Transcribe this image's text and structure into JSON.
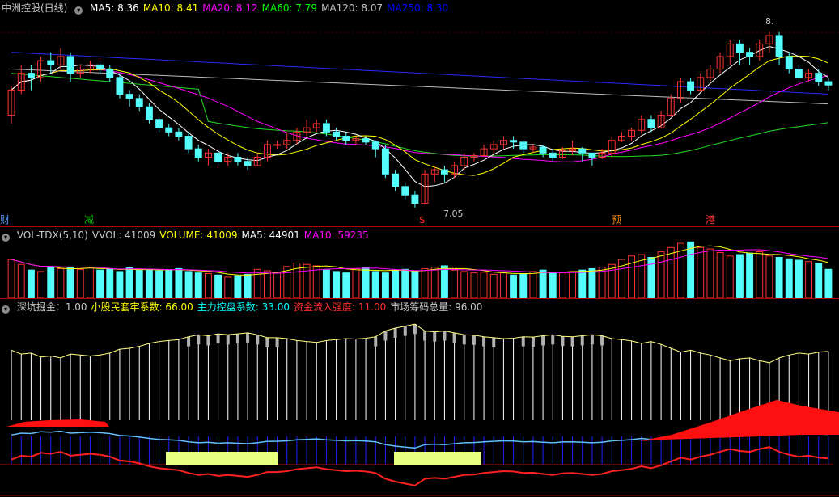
{
  "price_panel": {
    "title": "中洲控股(日线)",
    "indicators": [
      {
        "label": "MA5: 8.36",
        "color": "#ffffff"
      },
      {
        "label": "MA10: 8.41",
        "color": "#ffff00"
      },
      {
        "label": "MA20: 8.12",
        "color": "#ff00ff"
      },
      {
        "label": "MA60: 7.79",
        "color": "#00ff00"
      },
      {
        "label": "MA120: 8.07",
        "color": "#c0c0c0"
      },
      {
        "label": "MA250: 8.30",
        "color": "#0000ff"
      }
    ],
    "high_label": "8.",
    "low_label": "7.05",
    "markers": [
      {
        "text": "财",
        "color": "#5a9aff"
      },
      {
        "text": "减",
        "color": "#00cc00"
      },
      {
        "text": "$",
        "color": "#ff3030"
      },
      {
        "text": "预",
        "color": "#ff8c00"
      },
      {
        "text": "港",
        "color": "#ff3030"
      }
    ]
  },
  "volume_panel": {
    "indicators": [
      {
        "label": "VOL-TDX(5,10)",
        "color": "#c8c8c8"
      },
      {
        "label": "VVOL: 41009",
        "color": "#c8c8c8"
      },
      {
        "label": "VOLUME: 41009",
        "color": "#ffff00"
      },
      {
        "label": "MA5: 44901",
        "color": "#ffffff"
      },
      {
        "label": "MA10: 59235",
        "color": "#ff00ff"
      }
    ]
  },
  "indicator_panel": {
    "indicators": [
      {
        "label": "深坑掘金：1.00",
        "color": "#c8c8c8"
      },
      {
        "label": "小股民套牢系数: 66.00",
        "color": "#ffff00"
      },
      {
        "label": "主力控盘系数: 33.00",
        "color": "#00ffff"
      },
      {
        "label": "资金流入强度: 11.00",
        "color": "#ff3030"
      },
      {
        "label": "市场筹码总量: 96.00",
        "color": "#c8c8c8"
      }
    ]
  },
  "colors": {
    "up": "#ff3232",
    "down": "#54fcfc",
    "background": "#000000",
    "grid": "#b00000"
  },
  "chart_data": {
    "type": "candlestick",
    "candles": [
      [
        8.0,
        8.3,
        7.9,
        8.35
      ],
      [
        8.3,
        8.5,
        8.25,
        8.6
      ],
      [
        8.5,
        8.45,
        8.3,
        8.6
      ],
      [
        8.45,
        8.65,
        8.4,
        8.7
      ],
      [
        8.65,
        8.6,
        8.5,
        8.75
      ],
      [
        8.6,
        8.7,
        8.55,
        8.8
      ],
      [
        8.7,
        8.5,
        8.4,
        8.75
      ],
      [
        8.5,
        8.55,
        8.45,
        8.6
      ],
      [
        8.55,
        8.6,
        8.5,
        8.65
      ],
      [
        8.6,
        8.55,
        8.5,
        8.65
      ],
      [
        8.55,
        8.45,
        8.4,
        8.6
      ],
      [
        8.45,
        8.25,
        8.2,
        8.5
      ],
      [
        8.25,
        8.2,
        8.1,
        8.3
      ],
      [
        8.2,
        8.1,
        8.05,
        8.25
      ],
      [
        8.1,
        7.95,
        7.9,
        8.15
      ],
      [
        7.95,
        7.85,
        7.8,
        8.0
      ],
      [
        7.85,
        7.8,
        7.75,
        7.9
      ],
      [
        7.8,
        7.75,
        7.7,
        7.85
      ],
      [
        7.75,
        7.6,
        7.55,
        7.8
      ],
      [
        7.6,
        7.5,
        7.45,
        7.65
      ],
      [
        7.5,
        7.55,
        7.4,
        7.6
      ],
      [
        7.55,
        7.45,
        7.4,
        7.6
      ],
      [
        7.45,
        7.5,
        7.4,
        7.55
      ],
      [
        7.5,
        7.45,
        7.4,
        7.55
      ],
      [
        7.45,
        7.4,
        7.35,
        7.5
      ],
      [
        7.4,
        7.5,
        7.4,
        7.55
      ],
      [
        7.5,
        7.65,
        7.45,
        7.7
      ],
      [
        7.65,
        7.65,
        7.6,
        7.7
      ],
      [
        7.65,
        7.7,
        7.6,
        7.8
      ],
      [
        7.7,
        7.8,
        7.65,
        7.85
      ],
      [
        7.8,
        7.85,
        7.75,
        7.95
      ],
      [
        7.85,
        7.9,
        7.8,
        7.95
      ],
      [
        7.9,
        7.8,
        7.75,
        7.95
      ],
      [
        7.8,
        7.75,
        7.7,
        7.85
      ],
      [
        7.75,
        7.7,
        7.65,
        7.8
      ],
      [
        7.7,
        7.72,
        7.65,
        7.75
      ],
      [
        7.72,
        7.68,
        7.65,
        7.75
      ],
      [
        7.68,
        7.6,
        7.5,
        7.7
      ],
      [
        7.6,
        7.3,
        7.25,
        7.65
      ],
      [
        7.3,
        7.15,
        7.1,
        7.35
      ],
      [
        7.15,
        7.05,
        7.0,
        7.2
      ],
      [
        7.05,
        6.95,
        6.9,
        7.1
      ],
      [
        6.95,
        7.3,
        6.95,
        7.35
      ],
      [
        7.3,
        7.35,
        7.2,
        7.4
      ],
      [
        7.35,
        7.3,
        7.2,
        7.4
      ],
      [
        7.3,
        7.4,
        7.25,
        7.45
      ],
      [
        7.4,
        7.5,
        7.35,
        7.55
      ],
      [
        7.5,
        7.52,
        7.45,
        7.55
      ],
      [
        7.52,
        7.6,
        7.5,
        7.65
      ],
      [
        7.6,
        7.65,
        7.55,
        7.7
      ],
      [
        7.65,
        7.7,
        7.6,
        7.75
      ],
      [
        7.7,
        7.68,
        7.6,
        7.75
      ],
      [
        7.68,
        7.6,
        7.55,
        7.7
      ],
      [
        7.6,
        7.62,
        7.55,
        7.65
      ],
      [
        7.62,
        7.55,
        7.5,
        7.65
      ],
      [
        7.55,
        7.5,
        7.45,
        7.6
      ],
      [
        7.5,
        7.58,
        7.48,
        7.62
      ],
      [
        7.58,
        7.6,
        7.52,
        7.7
      ],
      [
        7.6,
        7.55,
        7.45,
        7.62
      ],
      [
        7.55,
        7.5,
        7.4,
        7.55
      ],
      [
        7.5,
        7.55,
        7.48,
        7.6
      ],
      [
        7.55,
        7.7,
        7.5,
        7.75
      ],
      [
        7.7,
        7.75,
        7.68,
        7.8
      ],
      [
        7.75,
        7.82,
        7.7,
        7.85
      ],
      [
        7.82,
        7.95,
        7.78,
        8.0
      ],
      [
        7.95,
        7.85,
        7.8,
        8.0
      ],
      [
        7.85,
        8.0,
        7.85,
        8.05
      ],
      [
        8.0,
        8.2,
        7.98,
        8.25
      ],
      [
        8.2,
        8.4,
        8.15,
        8.45
      ],
      [
        8.4,
        8.3,
        8.25,
        8.45
      ],
      [
        8.3,
        8.45,
        8.28,
        8.5
      ],
      [
        8.45,
        8.55,
        8.4,
        8.6
      ],
      [
        8.55,
        8.7,
        8.5,
        8.75
      ],
      [
        8.7,
        8.85,
        8.6,
        8.9
      ],
      [
        8.85,
        8.75,
        8.6,
        8.9
      ],
      [
        8.75,
        8.7,
        8.6,
        8.8
      ],
      [
        8.7,
        8.85,
        8.65,
        8.9
      ],
      [
        8.85,
        8.95,
        8.75,
        9.0
      ],
      [
        8.95,
        8.7,
        8.6,
        9.0
      ],
      [
        8.7,
        8.55,
        8.5,
        8.75
      ],
      [
        8.55,
        8.45,
        8.4,
        8.6
      ],
      [
        8.45,
        8.5,
        8.4,
        8.55
      ],
      [
        8.5,
        8.4,
        8.35,
        8.55
      ],
      [
        8.4,
        8.36,
        8.3,
        8.45
      ]
    ],
    "volume": [
      55,
      48,
      40,
      38,
      45,
      42,
      44,
      41,
      43,
      40,
      42,
      38,
      43,
      40,
      41,
      39,
      40,
      42,
      38,
      36,
      35,
      33,
      30,
      32,
      34,
      41,
      39,
      37,
      45,
      50,
      48,
      46,
      40,
      38,
      36,
      42,
      44,
      38,
      36,
      40,
      41,
      38,
      42,
      44,
      46,
      40,
      38,
      36,
      37,
      34,
      36,
      33,
      35,
      38,
      40,
      37,
      36,
      38,
      40,
      42,
      44,
      48,
      55,
      60,
      62,
      58,
      66,
      72,
      78,
      80,
      72,
      70,
      65,
      60,
      62,
      64,
      66,
      60,
      58,
      56,
      54,
      52,
      50,
      41
    ]
  }
}
